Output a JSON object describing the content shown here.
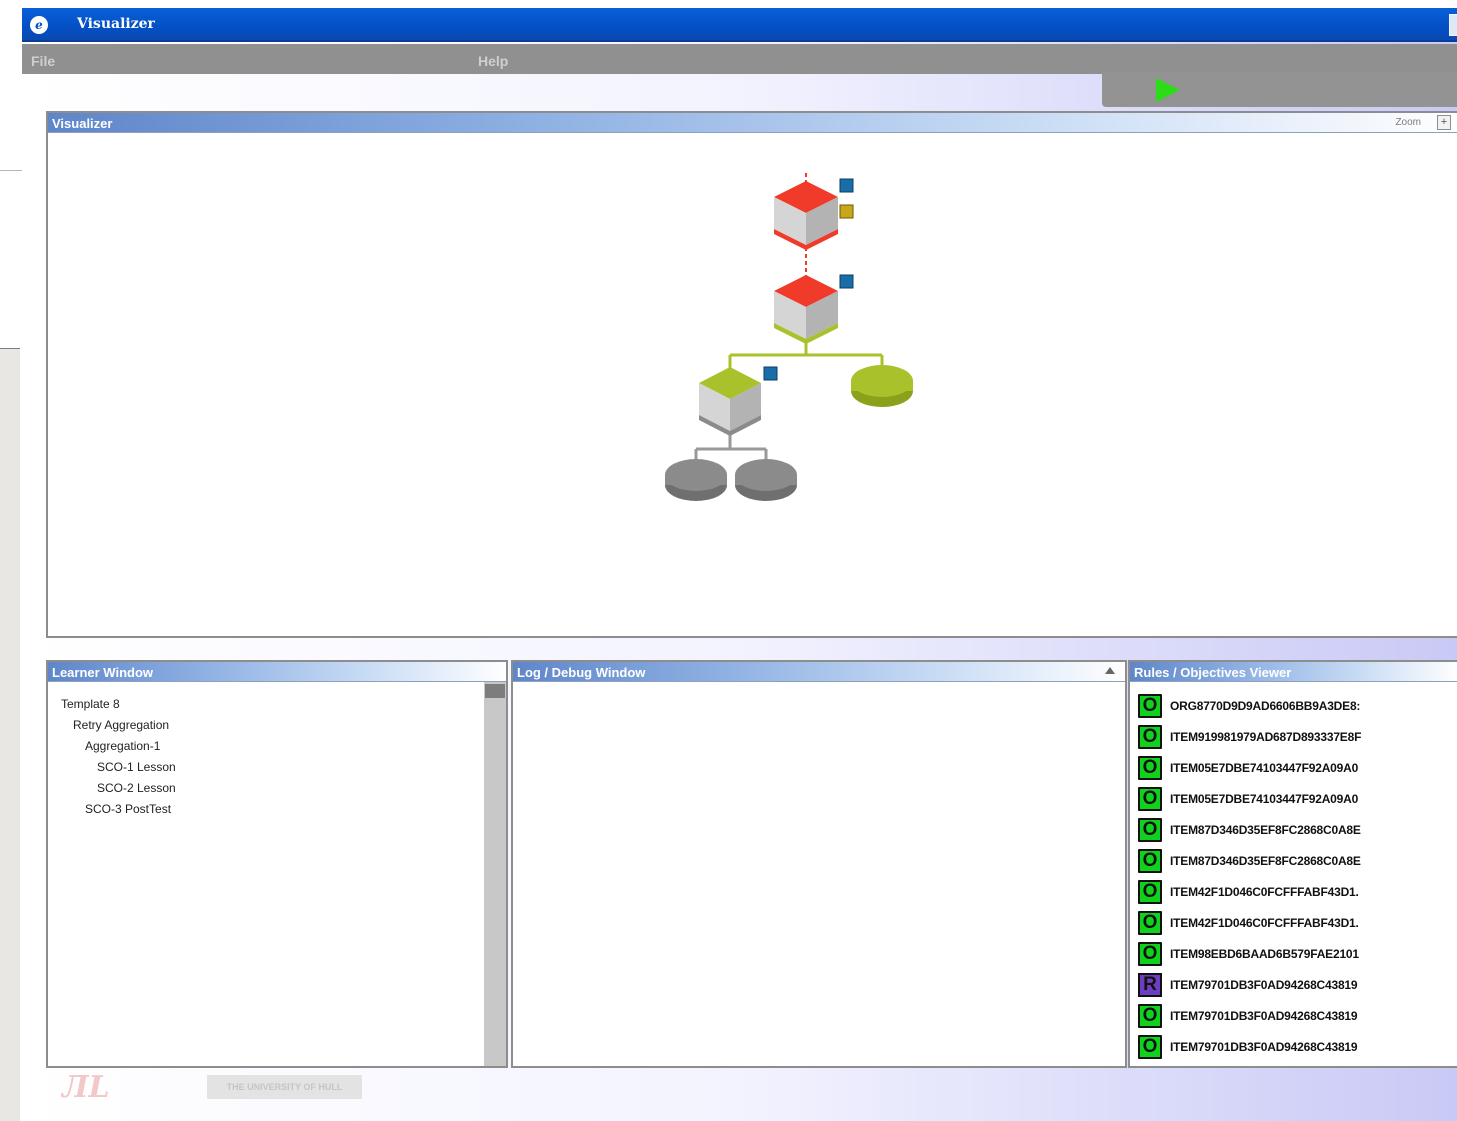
{
  "window": {
    "title": "Visualizer"
  },
  "menu": {
    "file": "File",
    "help": "Help"
  },
  "toolbar": {
    "play_icon": "play-icon",
    "play_color": "#2bdc16"
  },
  "visualizer": {
    "title": "Visualizer",
    "zoom_label": "Zoom",
    "zoom_in": "+",
    "colors": {
      "failed": "#f03a2a",
      "passed": "#a9c12a",
      "neutral": "#8b8b8b"
    }
  },
  "learner": {
    "title": "Learner Window",
    "items": [
      {
        "label": "Template 8",
        "level": 0
      },
      {
        "label": "Retry Aggregation",
        "level": 1
      },
      {
        "label": "Aggregation-1",
        "level": 2
      },
      {
        "label": "SCO-1 Lesson",
        "level": 3
      },
      {
        "label": "SCO-2 Lesson",
        "level": 3
      },
      {
        "label": "SCO-3 PostTest",
        "level": 2
      }
    ]
  },
  "log": {
    "title": "Log / Debug Window"
  },
  "rules": {
    "title": "Rules / Objectives Viewer",
    "rows": [
      {
        "badge": "O",
        "text": "ORG8770D9D9AD6606BB9A3DE8:"
      },
      {
        "badge": "O",
        "text": "ITEM919981979AD687D893337E8F"
      },
      {
        "badge": "O",
        "text": "ITEM05E7DBE74103447F92A09A0"
      },
      {
        "badge": "O",
        "text": "ITEM05E7DBE74103447F92A09A0"
      },
      {
        "badge": "O",
        "text": "ITEM87D346D35EF8FC2868C0A8E"
      },
      {
        "badge": "O",
        "text": "ITEM87D346D35EF8FC2868C0A8E"
      },
      {
        "badge": "O",
        "text": "ITEM42F1D046C0FCFFFABF43D1."
      },
      {
        "badge": "O",
        "text": "ITEM42F1D046C0FCFFFABF43D1."
      },
      {
        "badge": "O",
        "text": "ITEM98EBD6BAAD6B579FAE2101"
      },
      {
        "badge": "R",
        "text": "ITEM79701DB3F0AD94268C43819"
      },
      {
        "badge": "O",
        "text": "ITEM79701DB3F0AD94268C43819"
      },
      {
        "badge": "O",
        "text": "ITEM79701DB3F0AD94268C43819"
      }
    ]
  }
}
